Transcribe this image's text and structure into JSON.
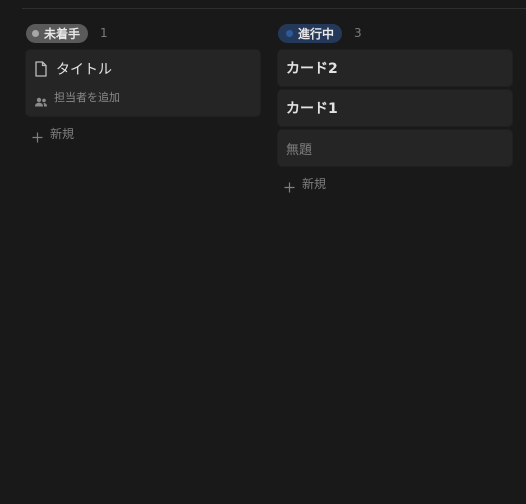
{
  "board": {
    "columns": [
      {
        "status": "未着手",
        "count": "1",
        "colors": {
          "pill": "#5a5a5a",
          "dot": "#a7a7a7"
        },
        "cards": [
          {
            "title": "タイトル",
            "icon": "document-icon",
            "assignee_placeholder": "担当者を追加",
            "assignee_icon": "people-icon"
          }
        ],
        "new_label": "新規"
      },
      {
        "status": "進行中",
        "count": "3",
        "colors": {
          "pill": "#24395a",
          "dot": "#2f5a96"
        },
        "cards": [
          {
            "title": "カード2"
          },
          {
            "title": "カード1"
          },
          {
            "title": "無題"
          }
        ],
        "new_label": "新規"
      }
    ]
  },
  "theme": {
    "background": "#191919",
    "card_background": "#252525"
  }
}
